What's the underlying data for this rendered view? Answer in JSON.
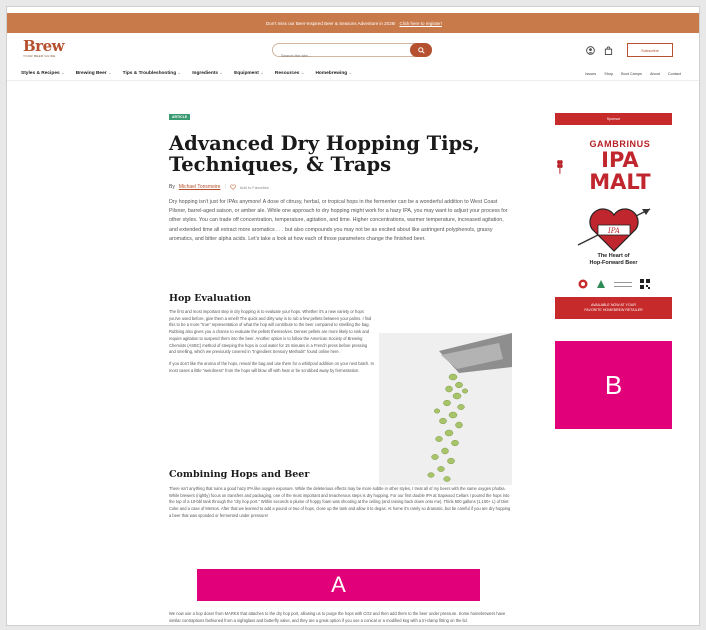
{
  "banner": {
    "text": "Don't miss our Beer-Inspired Beer & Seasons Adventure in 2026!",
    "link": "Click here to register!"
  },
  "header": {
    "logo_word": "Brew",
    "logo_sub": "YOUR BEER GUIDE",
    "search_placeholder": "Search the site...",
    "subscribe_label": "Subscribe"
  },
  "nav": {
    "items": [
      {
        "label": "Styles & Recipes"
      },
      {
        "label": "Brewing Beer"
      },
      {
        "label": "Tips & Troubleshooting"
      },
      {
        "label": "Ingredients"
      },
      {
        "label": "Equipment"
      },
      {
        "label": "Resources"
      },
      {
        "label": "Homebrewing"
      }
    ],
    "right_items": [
      {
        "label": "Issues"
      },
      {
        "label": "Shop"
      },
      {
        "label": "Boot Camps"
      },
      {
        "label": "About"
      },
      {
        "label": "Contact"
      }
    ]
  },
  "article": {
    "badge": "ARTICLE",
    "title": "Advanced Dry Hopping Tips, Techniques, & Traps",
    "by": "By",
    "author": "Michael Tonsmeire",
    "add_favorites": "Add to Favorites",
    "intro": "Dry hopping isn't just for IPAs anymore! A dose of citrusy, herbal, or tropical hops in the fermenter can be a wonderful addition to West Coast Pilsner, barrel-aged saison, or amber ale. While one approach to dry hopping might work for a hazy IPA, you may want to adjust your process for other styles. You can trade off concentration, temperature, agitation, and time. Higher concentrations, warmer temperature, increased agitation, and extended time all extract more aromatics . . . but also compounds you may not be as excited about like astringent polyphenols, grassy aromatics, and bitter alpha acids. Let's take a look at how each of those parameters change the finished beer.",
    "section1_heading": "Hop Evaluation",
    "section1_p1": "The first and most important step in dry hopping is to evaluate your hops. Whether it's a new variety or hops you've used before, give them a smell! The quick and dirty way is to rub a few pellets between your palms. I find this to be a more \"true\" representation of what the hop will contribute to the beer compared to smelling the bag. Rubbing also gives you a chance to evaluate the pellets themselves. Denser pellets are more likely to sink and require agitation to suspend them into the beer. Another option is to follow the American Society of Brewing Chemists (ASBC) method of steeping the hops in cool water for 15 minutes in a French press before pressing and smelling, which we previously covered in \"Ingredient Sensory Methods\" found online here.",
    "section1_p2": "If you don't like the aroma of the hops, reseal the bag and use them for a whirlpool addition on your next batch. In most cases a little \"weirdness\" from the hops will blow off with heat or be scrubbed away by fermentation.",
    "section2_heading": "Combining Hops and Beer",
    "section2_p1": "There isn't anything that ruins a good hazy IPA like oxygen exposure. While the deleterious effects may be more subtle in other styles, I treat all of my beers with the same oxygen phobia. While brewers (rightly) focus on transfers and packaging, one of the most important and treacherous steps is dry hopping. For our first double IPA at Sapwood Cellars I poured the hops into the top of a 10-bbl tank through the \"dry hop port.\" Within seconds a plume of hoppy foam was shooting at the ceiling (and raining back down onto me). Think 500 gallons (1,100+ L) of Diet Coke and a case of Mentos. After that we learned to add a pound or two of hops, close up the tank and allow it to degas. At home it's rarely so dramatic, but be careful if you are dry hopping a beer that was spunded or fermented under pressure!",
    "ad_letter": "A",
    "bottom_p": "We now use a hop doser from MARKS that attaches to the dry hop port, allowing us to purge the hops with CO2 and then add them to the beer under pressure. Some homebrewers have similar contraptions fashioned from a sightglass and butterfly valve, and they are a great option if you use a conical or a modified keg with a tri-clamp fitting on the lid."
  },
  "sidebar": {
    "top_label": "Sponsor",
    "gambrinus": "GAMBRINUS",
    "ipa_malt": "IPA MALT",
    "heart_ipa": "IPA",
    "heart_caption_1": "The Heart of",
    "heart_caption_2": "Hop-Forward Beer",
    "cta_line1": "AVAILABLE NOW AT YOUR",
    "cta_line2": "FAVORITE HOMEBREW RETAILER",
    "ad_letter": "B"
  },
  "colors": {
    "brand": "#b5512e",
    "banner": "#c97a4a",
    "ad_magenta": "#e2007a",
    "sidebar_red": "#c62a2a",
    "badge_green": "#3a9a72"
  }
}
